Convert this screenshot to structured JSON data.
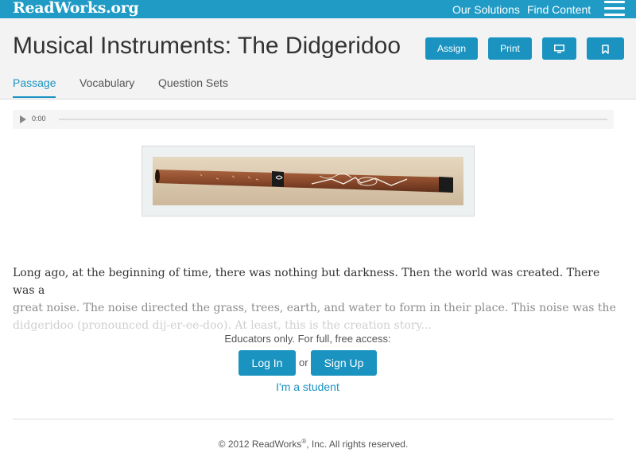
{
  "topbar": {
    "logo": "ReadWorks.org",
    "nav": {
      "solutions": "Our Solutions",
      "find_content": "Find Content"
    }
  },
  "header": {
    "title": "Musical Instruments: The Didgeridoo",
    "buttons": {
      "assign": "Assign",
      "print": "Print"
    },
    "tabs": {
      "passage": "Passage",
      "vocabulary": "Vocabulary",
      "question_sets": "Question Sets"
    }
  },
  "audio": {
    "time": "0:00",
    "progress": 0
  },
  "passage": {
    "line1": "Long ago, at the beginning of time, there was nothing but darkness. Then the world was created. There was a",
    "line2": "great noise. The noise directed the grass, trees, earth, and water to form in their place. This noise was the",
    "line3": "didgeridoo (pronounced dij-er-ee-doo). At least, this is the creation story..."
  },
  "access": {
    "note": "Educators only. For full, free access:",
    "login": "Log In",
    "or": "or",
    "signup": "Sign Up",
    "student": "I'm a student"
  },
  "footer": {
    "prefix": "© 2012 ReadWorks",
    "reg": "®",
    "suffix": ", Inc. All rights reserved."
  },
  "colors": {
    "brand": "#1f9bc6",
    "button": "#1a93c0"
  },
  "icons": {
    "menu": "hamburger-icon",
    "present": "monitor-icon",
    "bookmark": "bookmark-icon",
    "play": "play-icon"
  }
}
